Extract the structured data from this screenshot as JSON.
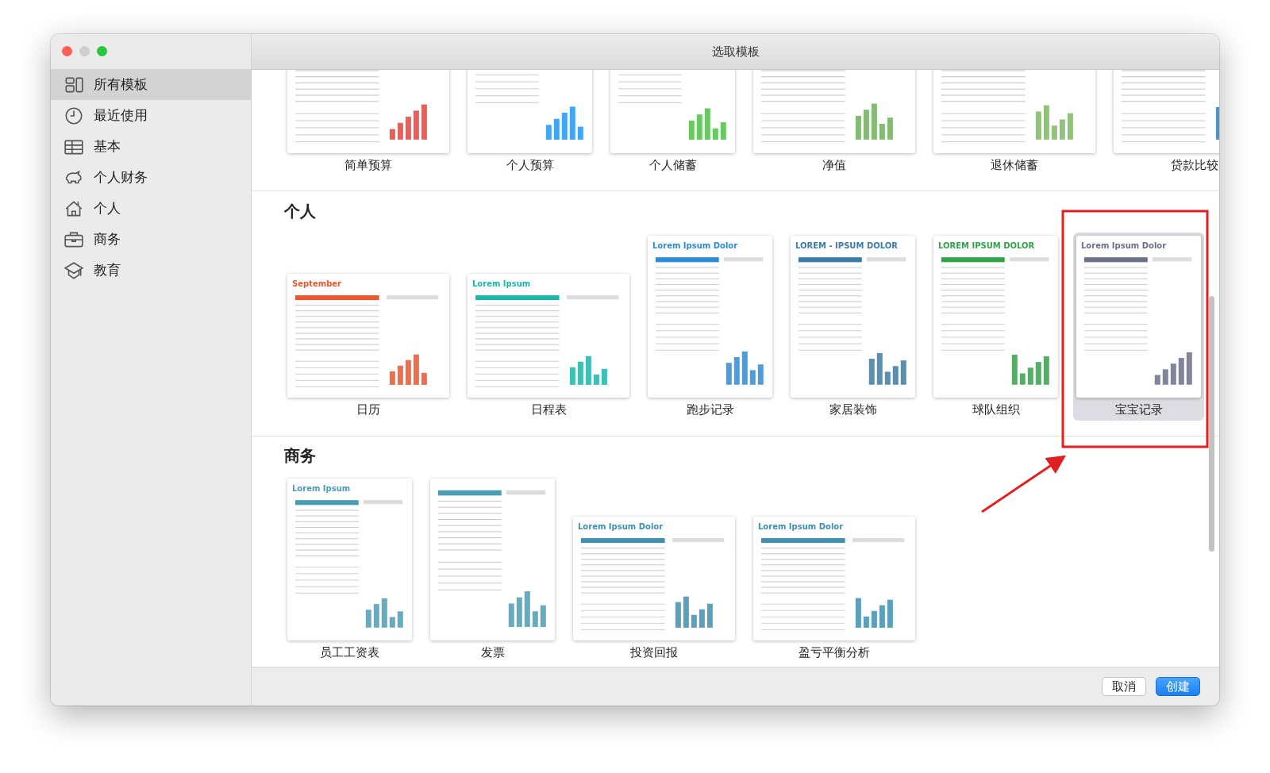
{
  "window": {
    "title": "选取模板"
  },
  "sidebar": {
    "items": [
      {
        "label": "所有模板",
        "selected": true
      },
      {
        "label": "最近使用",
        "selected": false
      },
      {
        "label": "基本",
        "selected": false
      },
      {
        "label": "个人财务",
        "selected": false
      },
      {
        "label": "个人",
        "selected": false
      },
      {
        "label": "商务",
        "selected": false
      },
      {
        "label": "教育",
        "selected": false
      }
    ]
  },
  "sections": [
    {
      "templates": [
        {
          "name": "简单预算",
          "kind": "landscape",
          "selected": false
        },
        {
          "name": "个人预算",
          "kind": "portrait",
          "selected": false
        },
        {
          "name": "个人储蓄",
          "kind": "portrait",
          "selected": false
        },
        {
          "name": "净值",
          "kind": "landscape",
          "selected": false
        },
        {
          "name": "退休储蓄",
          "kind": "landscape",
          "selected": false
        },
        {
          "name": "贷款比较",
          "kind": "landscape",
          "selected": false
        }
      ]
    },
    {
      "title": "个人",
      "templates": [
        {
          "name": "日历",
          "kind": "landscape",
          "headline": "September",
          "selected": false
        },
        {
          "name": "日程表",
          "kind": "landscape",
          "headline": "Lorem Ipsum",
          "selected": false
        },
        {
          "name": "跑步记录",
          "kind": "portrait",
          "headline": "Lorem Ipsum Dolor",
          "selected": false
        },
        {
          "name": "家居装饰",
          "kind": "portrait",
          "headline": "LOREM - IPSUM DOLOR",
          "selected": false
        },
        {
          "name": "球队组织",
          "kind": "portrait",
          "headline": "LOREM IPSUM DOLOR",
          "selected": false
        },
        {
          "name": "宝宝记录",
          "kind": "portrait",
          "headline": "Lorem Ipsum Dolor",
          "selected": true
        }
      ]
    },
    {
      "title": "商务",
      "templates": [
        {
          "name": "员工工资表",
          "kind": "portrait",
          "headline": "Lorem Ipsum",
          "selected": false
        },
        {
          "name": "发票",
          "kind": "portrait",
          "selected": false
        },
        {
          "name": "投资回报",
          "kind": "landscape",
          "headline": "Lorem Ipsum Dolor",
          "selected": false
        },
        {
          "name": "盈亏平衡分析",
          "kind": "landscape",
          "headline": "Lorem Ipsum Dolor",
          "selected": false
        }
      ]
    }
  ],
  "buttons": [
    {
      "label": "取消",
      "kind": "secondary"
    },
    {
      "label": "创建",
      "kind": "primary"
    }
  ]
}
